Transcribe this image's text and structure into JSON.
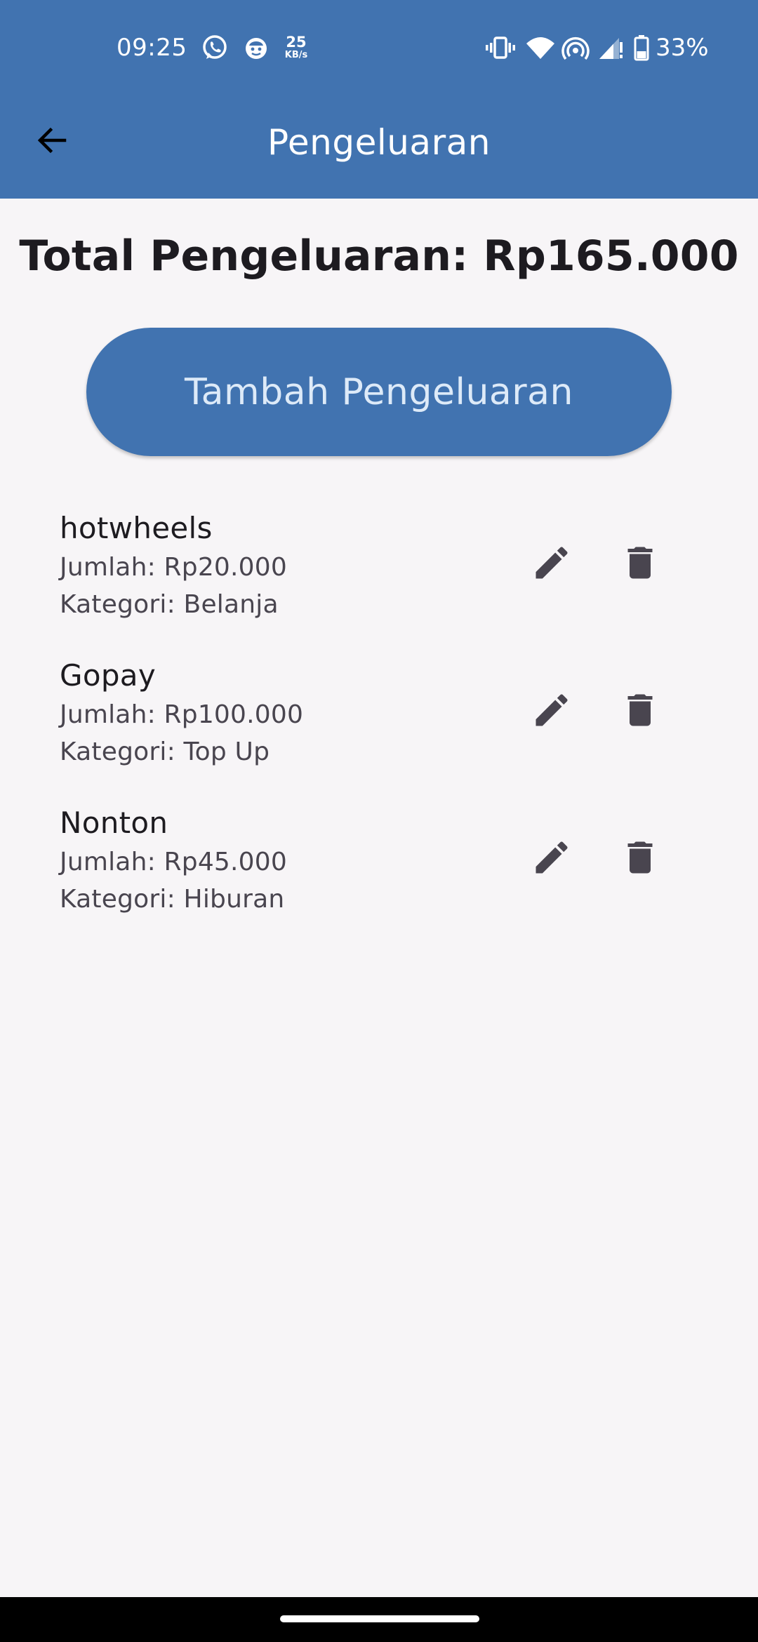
{
  "status_bar": {
    "time": "09:25",
    "net_speed_value": "25",
    "net_speed_unit": "KB/s",
    "battery": "33%",
    "icons": [
      "whatsapp-icon",
      "app-notification-icon",
      "vibrate-icon",
      "wifi-icon",
      "hotspot-icon",
      "signal-icon",
      "battery-icon"
    ]
  },
  "app_bar": {
    "back_icon": "arrow-back-icon",
    "title": "Pengeluaran"
  },
  "summary": {
    "total_text": "Total Pengeluaran: Rp165.000"
  },
  "actions": {
    "add_label": "Tambah Pengeluaran"
  },
  "expenses": [
    {
      "name": "hotwheels",
      "amount": "Jumlah: Rp20.000",
      "category": "Kategori: Belanja"
    },
    {
      "name": "Gopay",
      "amount": "Jumlah: Rp100.000",
      "category": "Kategori: Top Up"
    },
    {
      "name": "Nonton",
      "amount": "Jumlah: Rp45.000",
      "category": "Kategori: Hiburan"
    }
  ],
  "colors": {
    "primary": "#4173b0",
    "background": "#f7f5f7",
    "icon": "#49454f",
    "text": "#1d1b20"
  }
}
